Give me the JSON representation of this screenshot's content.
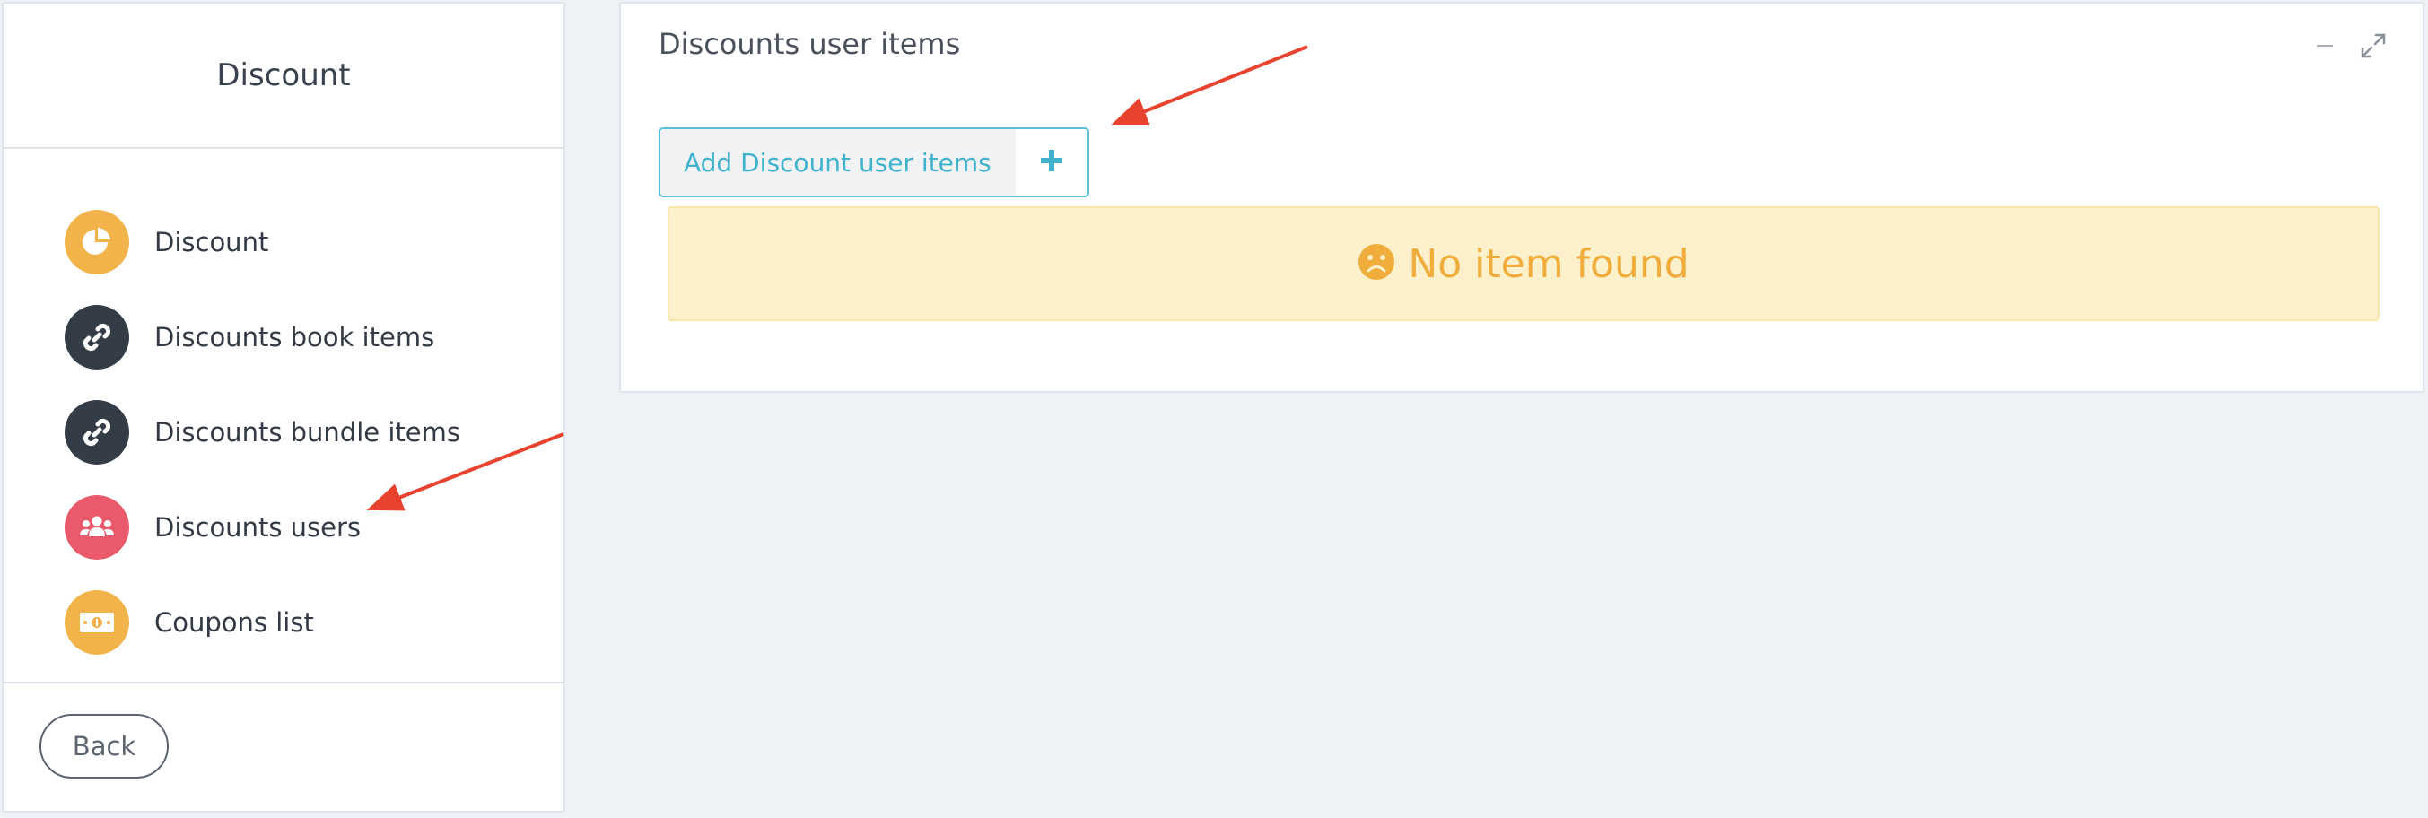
{
  "sidebar": {
    "title": "Discount",
    "items": [
      {
        "label": "Discount",
        "icon": "pie-chart-icon",
        "color": "#f2b34a"
      },
      {
        "label": "Discounts book items",
        "icon": "link-icon",
        "color": "#343c48"
      },
      {
        "label": "Discounts bundle items",
        "icon": "link-icon",
        "color": "#343c48"
      },
      {
        "label": "Discounts users",
        "icon": "users-icon",
        "color": "#ea5a6c"
      },
      {
        "label": "Coupons list",
        "icon": "money-icon",
        "color": "#f2b34a"
      }
    ],
    "back_label": "Back"
  },
  "panel": {
    "title": "Discounts user items",
    "add_button_label": "Add Discount user items",
    "empty_message": "No item found",
    "tools": [
      "minimize-icon",
      "expand-icon"
    ]
  },
  "colors": {
    "accent": "#3fb2cc",
    "warning_text": "#f0ad3c",
    "warning_bg": "#fdf1cc",
    "annotation_arrow": "#e8432e"
  }
}
